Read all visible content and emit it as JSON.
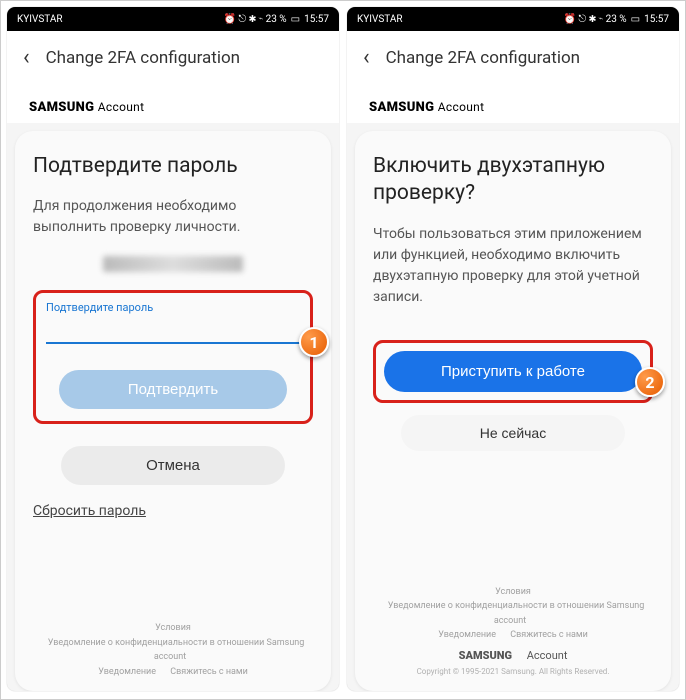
{
  "status": {
    "carrier": "KYIVSTAR",
    "icons": "⏰ ⎋ ✱ ⌁ 23 %",
    "battery_icon": "▭",
    "time": "15:57"
  },
  "header": {
    "back_glyph": "‹",
    "title": "Change 2FA configuration"
  },
  "brand": {
    "samsung": "SAMSUNG",
    "account": "Account"
  },
  "left": {
    "title": "Подтвердите пароль",
    "desc": "Для продолжения необходимо выполнить проверку личности.",
    "input_label": "Подтвердите пароль",
    "confirm": "Подтвердить",
    "cancel": "Отмена",
    "reset": "Сбросить пароль",
    "footer1": "Условия",
    "footer2": "Уведомление о конфиденциальности в отношении Samsung account",
    "footer3a": "Уведомление",
    "footer3b": "Свяжитесь с нами"
  },
  "right": {
    "title": "Включить двухэтапную проверку?",
    "desc": "Чтобы пользоваться этим приложением или функцией, необходимо включить двухэтапную проверку для этой учетной записи.",
    "start": "Приступить к работе",
    "later": "Не сейчас",
    "footer1": "Условия",
    "footer2": "Уведомление о конфиденциальности в отношении Samsung account",
    "footer3a": "Уведомление",
    "footer3b": "Свяжитесь с нами",
    "copy": "Copyright © 1995-2021 Samsung. All Rights Reserved."
  },
  "annotations": {
    "b1": "1",
    "b2": "2"
  }
}
